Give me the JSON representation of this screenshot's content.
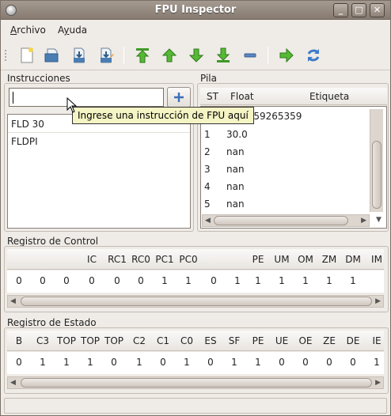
{
  "window": {
    "title": "FPU Inspector"
  },
  "menu": [
    {
      "label": "Archivo",
      "mnemonic": "A",
      "rest": "rchivo"
    },
    {
      "label": "Ayuda",
      "mnemonic": "y",
      "pre": "A",
      "rest": "uda"
    }
  ],
  "toolbar_icons": [
    "new-file-icon",
    "open-file-icon",
    "save-file-icon",
    "save-as-icon",
    "move-top-icon",
    "move-up-icon",
    "move-down-icon",
    "move-bottom-icon",
    "remove-icon",
    "execute-icon",
    "refresh-icon"
  ],
  "instrucciones": {
    "label": "Instrucciones",
    "input_value": "",
    "tooltip": "Ingrese una instrucción de FPU aquí",
    "items": [
      "FLD 30",
      "FLDPI"
    ]
  },
  "pila": {
    "label": "Pila",
    "columns": [
      "ST",
      "Float",
      "Etiqueta"
    ],
    "rows": [
      {
        "st": "0",
        "float": "3.14159265359",
        "etiqueta": ""
      },
      {
        "st": "1",
        "float": "30.0",
        "etiqueta": ""
      },
      {
        "st": "2",
        "float": "nan",
        "etiqueta": ""
      },
      {
        "st": "3",
        "float": "nan",
        "etiqueta": ""
      },
      {
        "st": "4",
        "float": "nan",
        "etiqueta": ""
      },
      {
        "st": "5",
        "float": "nan",
        "etiqueta": ""
      }
    ]
  },
  "control": {
    "label": "Registro de Control",
    "headers": [
      "",
      "",
      "",
      "IC",
      "RC1",
      "RC0",
      "PC1",
      "PC0",
      "",
      "PE",
      "UM",
      "OM",
      "ZM",
      "DM",
      "IM"
    ],
    "values": [
      "0",
      "0",
      "0",
      "0",
      "0",
      "0",
      "1",
      "1",
      "0",
      "1",
      "1",
      "1",
      "1",
      "1",
      "1"
    ]
  },
  "estado": {
    "label": "Registro de Estado",
    "headers": [
      "B",
      "C3",
      "TOP",
      "TOP",
      "TOP",
      "C2",
      "C1",
      "C0",
      "ES",
      "SF",
      "PE",
      "UE",
      "OE",
      "ZE",
      "DE",
      "IE"
    ],
    "values": [
      "0",
      "1",
      "1",
      "1",
      "0",
      "1",
      "0",
      "1",
      "0",
      "1",
      "1",
      "0",
      "0",
      "0",
      "0",
      "1"
    ]
  }
}
